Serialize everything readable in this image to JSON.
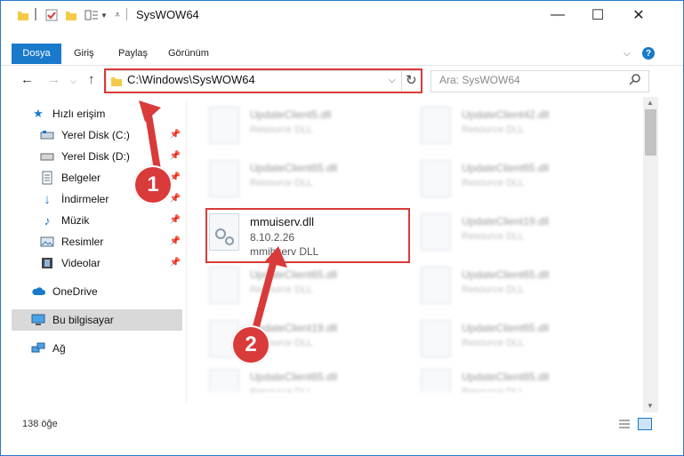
{
  "window": {
    "title": "SysWOW64",
    "minimize_glyph": "—",
    "maximize_glyph": "☐",
    "close_glyph": "✕"
  },
  "ribbon": {
    "tabs": [
      "Dosya",
      "Giriş",
      "Paylaş",
      "Görünüm"
    ]
  },
  "address_bar": {
    "path": "C:\\Windows\\SysWOW64"
  },
  "search": {
    "placeholder": "Ara: SysWOW64"
  },
  "sidebar": {
    "quick_access": "Hızlı erişim",
    "items": [
      {
        "label": "Yerel Disk (C:)",
        "icon": "drive-icon"
      },
      {
        "label": "Yerel Disk (D:)",
        "icon": "drive-icon"
      },
      {
        "label": "Belgeler",
        "icon": "documents-icon"
      },
      {
        "label": "İndirmeler",
        "icon": "download-icon"
      },
      {
        "label": "Müzik",
        "icon": "music-icon"
      },
      {
        "label": "Resimler",
        "icon": "pictures-icon"
      },
      {
        "label": "Videolar",
        "icon": "video-icon"
      }
    ],
    "onedrive": "OneDrive",
    "this_pc": "Bu bilgisayar",
    "network": "Ağ"
  },
  "files": [
    {
      "name": "UpdateClient5.dll",
      "type": "Resource DLL"
    },
    {
      "name": "UpdateClient42.dll",
      "type": "Resource DLL"
    },
    {
      "name": "UpdateClient65.dll",
      "type": "Resource DLL"
    },
    {
      "name": "UpdateClient65.dll",
      "type": "Resource DLL"
    },
    {
      "name": "mmuiserv.dll",
      "version": "8.10.2.26",
      "type": "mmibserv DLL"
    },
    {
      "name": "UpdateClient19.dll",
      "type": "Resource DLL"
    },
    {
      "name": "UpdateClient65.dll",
      "type": "Resource DLL"
    },
    {
      "name": "UpdateClient65.dll",
      "type": "Resource DLL"
    },
    {
      "name": "UpdateClient19.dll",
      "type": "Resource DLL"
    },
    {
      "name": "UpdateClient65.dll",
      "type": "Resource DLL"
    },
    {
      "name": "UpdateClient65.dll",
      "type": "Resource DLL"
    },
    {
      "name": "UpdateClient65.dll",
      "type": "Resource DLL"
    }
  ],
  "status": {
    "item_count": "138 öğe"
  },
  "annotations": {
    "step1": "1",
    "step2": "2",
    "color": "#d93a3a"
  }
}
